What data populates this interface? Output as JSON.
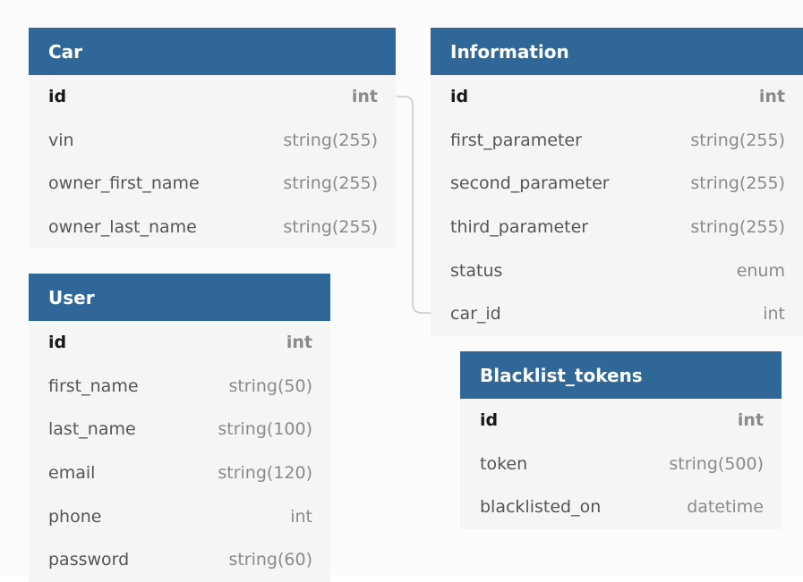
{
  "tables": {
    "car": {
      "name": "Car",
      "columns": [
        {
          "name": "id",
          "type": "int"
        },
        {
          "name": "vin",
          "type": "string(255)"
        },
        {
          "name": "owner_first_name",
          "type": "string(255)"
        },
        {
          "name": "owner_last_name",
          "type": "string(255)"
        }
      ]
    },
    "information": {
      "name": "Information",
      "columns": [
        {
          "name": "id",
          "type": "int"
        },
        {
          "name": "first_parameter",
          "type": "string(255)"
        },
        {
          "name": "second_parameter",
          "type": "string(255)"
        },
        {
          "name": "third_parameter",
          "type": "string(255)"
        },
        {
          "name": "status",
          "type": "enum"
        },
        {
          "name": "car_id",
          "type": "int"
        }
      ]
    },
    "user": {
      "name": "User",
      "columns": [
        {
          "name": "id",
          "type": "int"
        },
        {
          "name": "first_name",
          "type": "string(50)"
        },
        {
          "name": "last_name",
          "type": "string(100)"
        },
        {
          "name": "email",
          "type": "string(120)"
        },
        {
          "name": "phone",
          "type": "int"
        },
        {
          "name": "password",
          "type": "string(60)"
        }
      ]
    },
    "blacklist_tokens": {
      "name": "Blacklist_tokens",
      "columns": [
        {
          "name": "id",
          "type": "int"
        },
        {
          "name": "token",
          "type": "string(500)"
        },
        {
          "name": "blacklisted_on",
          "type": "datetime"
        }
      ]
    }
  },
  "relations": [
    {
      "from": "car.id",
      "to": "information.car_id"
    }
  ],
  "colors": {
    "header": "#2f6898",
    "connector": "#c8c8c8"
  }
}
